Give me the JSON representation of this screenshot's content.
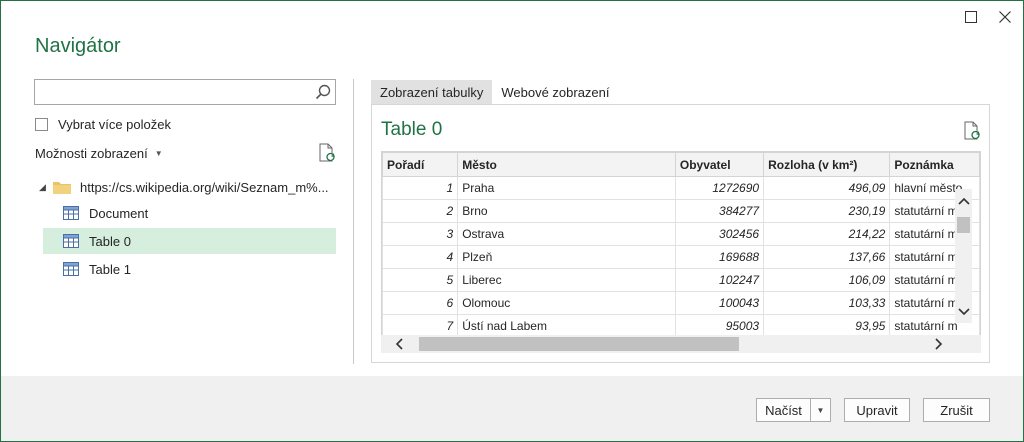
{
  "dialog": {
    "title": "Navigátor"
  },
  "left": {
    "search": {
      "value": "",
      "placeholder": ""
    },
    "select_multiple_label": "Vybrat více položek",
    "display_options_label": "Možnosti zobrazení",
    "tree": {
      "root_label": "https://cs.wikipedia.org/wiki/Seznam_m%...",
      "items": [
        {
          "label": "Document",
          "selected": false
        },
        {
          "label": "Table 0",
          "selected": true
        },
        {
          "label": "Table 1",
          "selected": false
        }
      ]
    }
  },
  "preview": {
    "tabs": [
      {
        "label": "Zobrazení tabulky",
        "active": true
      },
      {
        "label": "Webové zobrazení",
        "active": false
      }
    ],
    "title": "Table 0",
    "columns": [
      "Pořadí",
      "Město",
      "Obyvatel",
      "Rozloha (v km²)",
      "Poznámka"
    ],
    "rows": [
      [
        "1",
        "Praha",
        "1272690",
        "496,09",
        "hlavní město"
      ],
      [
        "2",
        "Brno",
        "384277",
        "230,19",
        "statutární m"
      ],
      [
        "3",
        "Ostrava",
        "302456",
        "214,22",
        "statutární m"
      ],
      [
        "4",
        "Plzeň",
        "169688",
        "137,66",
        "statutární m"
      ],
      [
        "5",
        "Liberec",
        "102247",
        "106,09",
        "statutární m"
      ],
      [
        "6",
        "Olomouc",
        "100043",
        "103,33",
        "statutární m"
      ],
      [
        "7",
        "Ústí nad Labem",
        "95003",
        "93,95",
        "statutární m"
      ]
    ]
  },
  "footer": {
    "load_label": "Načíst",
    "edit_label": "Upravit",
    "cancel_label": "Zrušit"
  },
  "colors": {
    "accent": "#217346",
    "selection": "#d5eedd",
    "footer_bg": "#f0f0f0"
  }
}
